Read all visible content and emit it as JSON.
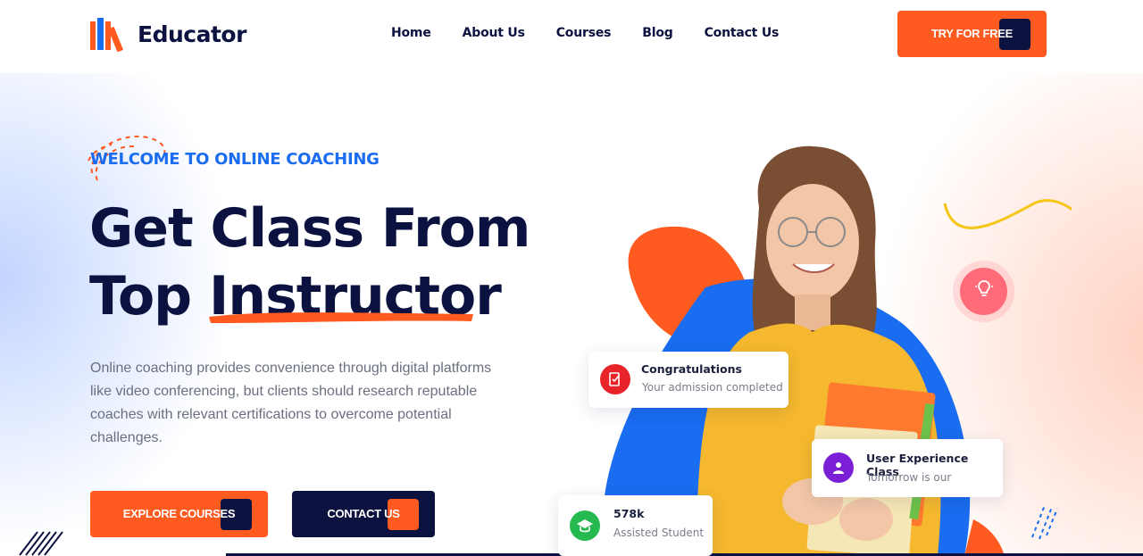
{
  "header": {
    "brand": "Educator",
    "nav": [
      "Home",
      "About Us",
      "Courses",
      "Blog",
      "Contact Us"
    ],
    "cta": "TRY FOR FREE"
  },
  "hero": {
    "tagline": "WELCOME TO ONLINE COACHING",
    "headline_line1": "Get Class From",
    "headline_line2_prefix": "Top ",
    "headline_line2_highlight": "Instructor",
    "description": "Online coaching provides convenience through digital platforms like video conferencing, but clients should research reputable coaches with relevant certifications to overcome potential challenges.",
    "explore_btn": "EXPLORE COURSES",
    "contact_btn": "CONTACT US"
  },
  "cards": {
    "congrats": {
      "title": "Congratulations",
      "subtitle": "Your admission completed"
    },
    "ux_class": {
      "title": "User Experience Class",
      "subtitle": "Tomorrow is our"
    },
    "students": {
      "count": "578k",
      "label": "Assisted Student"
    }
  },
  "icons": [
    "books-logo-icon",
    "admission-icon",
    "class-user-icon",
    "graduation-cap-icon",
    "lightbulb-icon"
  ],
  "colors": {
    "accent": "#ff5a1f",
    "navy": "#0b1240",
    "blue": "#1a6cf0",
    "pink": "#ff6b78",
    "yellow": "#f5c518"
  }
}
